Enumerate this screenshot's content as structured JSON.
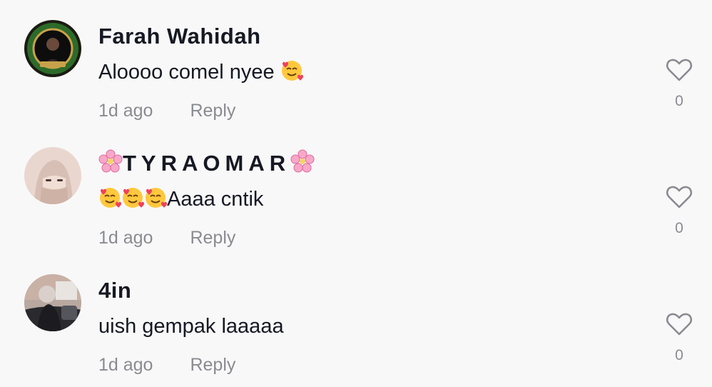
{
  "comments": [
    {
      "username": "Farah Wahidah",
      "text": "Aloooo comel nyee",
      "time": "1d ago",
      "reply_label": "Reply",
      "like_count": "0",
      "avatar_icon": "profile-photo-badge-frame"
    },
    {
      "username": "TYRAOMAR",
      "text": "Aaaa cntik",
      "time": "1d ago",
      "reply_label": "Reply",
      "like_count": "0",
      "avatar_icon": "profile-photo-niqab"
    },
    {
      "username": "4in",
      "text": "uish gempak laaaaa",
      "time": "1d ago",
      "reply_label": "Reply",
      "like_count": "0",
      "avatar_icon": "profile-photo-car"
    }
  ],
  "icons": {
    "like": "heart-outline-icon",
    "emoji_hearts": "smiling-face-with-hearts",
    "emoji_flower": "cherry-blossom"
  },
  "colors": {
    "background": "#f8f8f8",
    "primary_text": "#161823",
    "secondary_text": "#8a8b91"
  }
}
